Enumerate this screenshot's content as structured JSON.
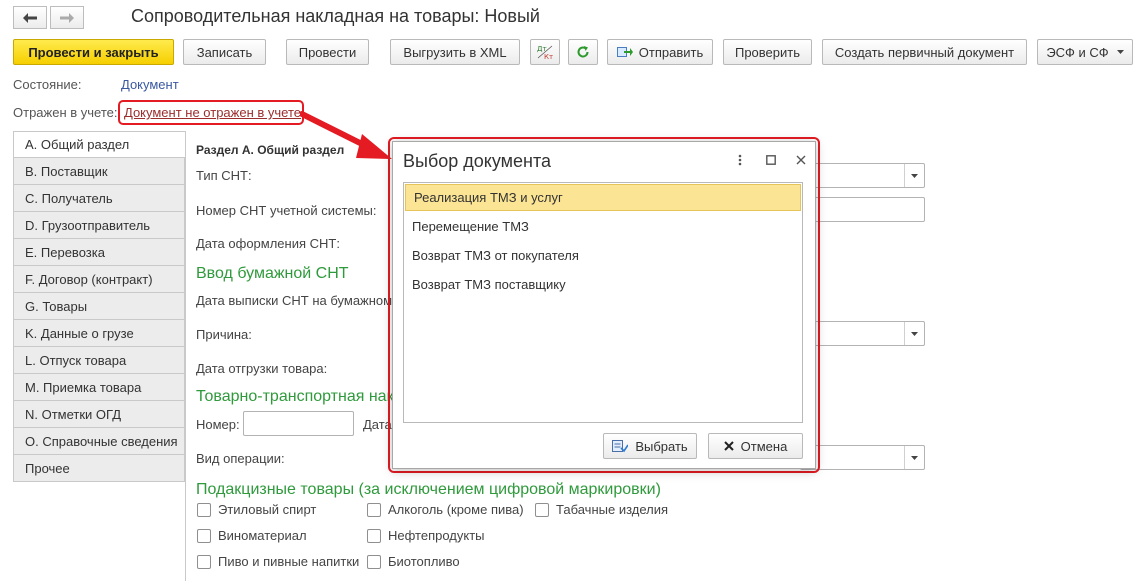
{
  "window": {
    "title": "Сопроводительная накладная на товары: Новый"
  },
  "toolbar": {
    "post_close": "Провести и закрыть",
    "save": "Записать",
    "post": "Провести",
    "export_xml": "Выгрузить в XML",
    "send": "Отправить",
    "check": "Проверить",
    "create_primary": "Создать первичный документ",
    "esf_sf": "ЭСФ и СФ",
    "dtkt_top": "Дт",
    "dtkt_bottom": "Кт"
  },
  "status": {
    "state_label": "Состояние:",
    "state_value": "Документ",
    "reflected_label": "Отражен в учете:",
    "reflected_value": "Документ не отражен в учете"
  },
  "tabs": [
    "А. Общий раздел",
    "В. Поставщик",
    "С. Получатель",
    "D. Грузоотправитель",
    "E. Перевозка",
    "F. Договор (контракт)",
    "G. Товары",
    "K. Данные о грузе",
    "L. Отпуск товара",
    "M. Приемка товара",
    "N. Отметки ОГД",
    "O. Справочные сведения",
    "Прочее"
  ],
  "form": {
    "section_title": "Раздел А. Общий раздел",
    "snt_type": "Тип СНТ:",
    "snt_number": "Номер СНТ учетной системы:",
    "snt_date": "Дата оформления СНТ:",
    "paper_heading": "Ввод бумажной СНТ",
    "paper_date": "Дата выписки СНТ на бумажном",
    "reason": "Причина:",
    "ship_date": "Дата отгрузки товара:",
    "ttn_heading": "Товарно-транспортная нак",
    "number": "Номер:",
    "date_short": "Дата",
    "operation": "Вид операции:",
    "excise_heading": "Подакцизные товары (за исключением цифровой маркировки)"
  },
  "checkboxes": [
    "Этиловый спирт",
    "Алкоголь (кроме пива)",
    "Табачные изделия",
    "Виноматериал",
    "Нефтепродукты",
    "Пиво и пивные напитки",
    "Биотопливо"
  ],
  "dialog": {
    "title": "Выбор документа",
    "items": [
      "Реализация ТМЗ и услуг",
      "Перемещение ТМЗ",
      "Возврат ТМЗ от покупателя",
      "Возврат ТМЗ поставщику"
    ],
    "select": "Выбрать",
    "cancel": "Отмена"
  },
  "colors": {
    "accent_yellow": "#f6cf00",
    "highlight_red": "#e41b23",
    "heading_green": "#2f9a3c",
    "selected_row": "#fbe494"
  }
}
